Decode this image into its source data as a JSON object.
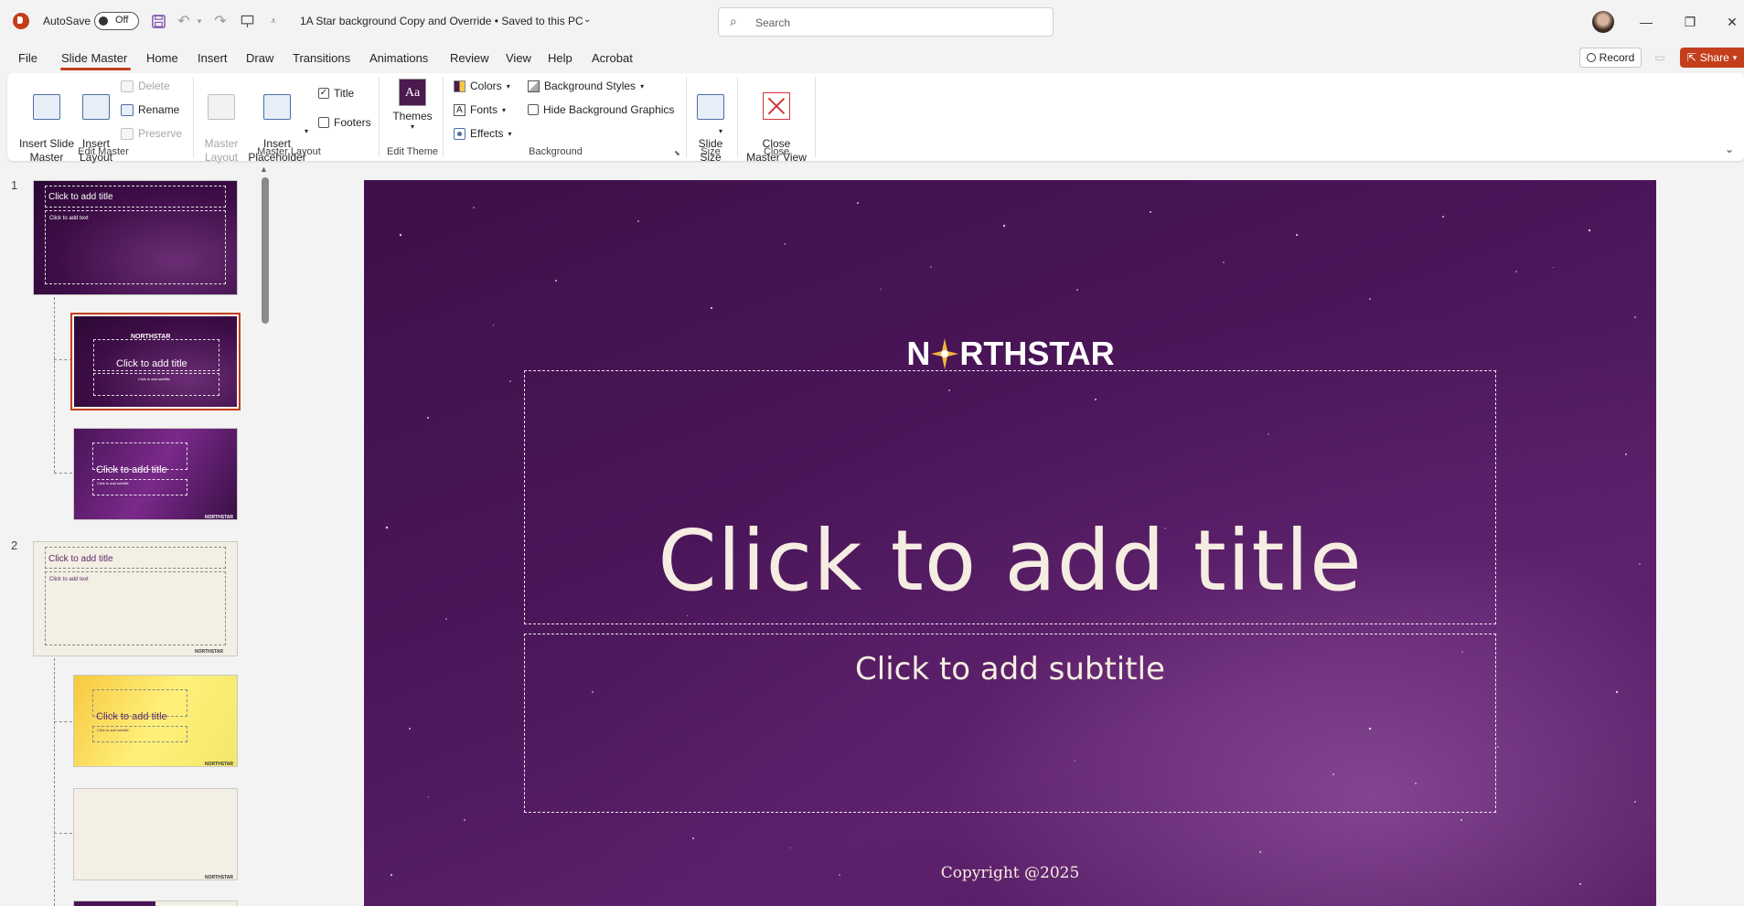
{
  "titlebar": {
    "autosave_label": "AutoSave",
    "autosave_state": "Off",
    "document_title": "1A Star background Copy and Override  •  Saved to this PC",
    "search_placeholder": "Search"
  },
  "menu": {
    "items": [
      "File",
      "Slide Master",
      "Home",
      "Insert",
      "Draw",
      "Transitions",
      "Animations",
      "Review",
      "View",
      "Help",
      "Acrobat"
    ],
    "active": "Slide Master",
    "record_label": "Record",
    "share_label": "Share"
  },
  "ribbon": {
    "edit_master": {
      "label": "Edit Master",
      "insert_slide_master": "Insert Slide\nMaster",
      "insert_layout": "Insert\nLayout",
      "delete": "Delete",
      "rename": "Rename",
      "preserve": "Preserve"
    },
    "master_layout": {
      "label": "Master Layout",
      "master_layout_btn": "Master\nLayout",
      "insert_placeholder": "Insert\nPlaceholder",
      "title_check": "Title",
      "footers_check": "Footers",
      "title_checked": true,
      "footers_checked": false
    },
    "edit_theme": {
      "label": "Edit Theme",
      "themes": "Themes"
    },
    "background": {
      "label": "Background",
      "colors": "Colors",
      "fonts": "Fonts",
      "effects": "Effects",
      "background_styles": "Background Styles",
      "hide_background_graphics": "Hide Background Graphics"
    },
    "size": {
      "label": "Size",
      "slide_size": "Slide\nSize"
    },
    "close": {
      "label": "Close",
      "close_master_view": "Close\nMaster View"
    }
  },
  "thumbnails": {
    "master1_number": "1",
    "master2_number": "2",
    "title_text": "Click to add title",
    "text_text": "Click to add text",
    "subtitle_text": "Click to add subtitle",
    "footer_brand": "NORTHSTAR"
  },
  "slide": {
    "logo_text_left": "N",
    "logo_text_right": "RTHSTAR",
    "title_placeholder": "Click to add title",
    "subtitle_placeholder": "Click to add subtitle",
    "copyright": "Copyright @2025"
  },
  "colors": {
    "accent": "#c43e1c",
    "slide_bg": "#4b1659",
    "placeholder_text": "#f5ede2"
  }
}
